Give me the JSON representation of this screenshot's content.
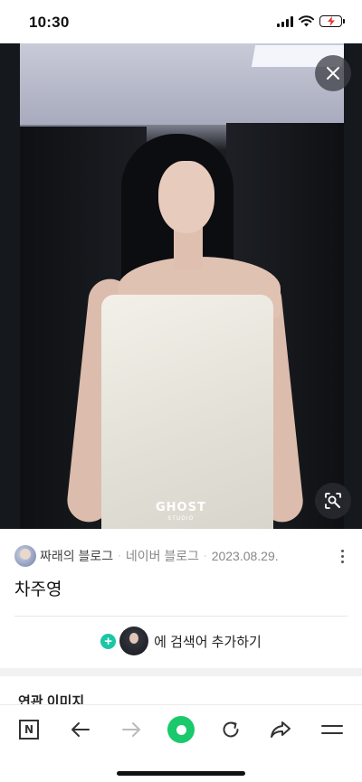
{
  "status_bar": {
    "time": "10:30",
    "icons": [
      "signal-icon",
      "wifi-icon",
      "battery-charging-icon"
    ]
  },
  "viewer": {
    "watermark": "GHOST",
    "watermark_sub": "STUDIO",
    "close_icon": "close-icon",
    "lens_icon": "image-search-icon"
  },
  "info": {
    "source_name": "짜래의 블로그",
    "source_site": "네이버 블로그",
    "date": "2023.08.29.",
    "title": "차주영",
    "add_search_label": "에 검색어 추가하기",
    "related_heading": "연관 이미지"
  },
  "toolbar": {
    "items": [
      "n-home-icon",
      "back-icon",
      "forward-icon",
      "green-dot-icon",
      "refresh-icon",
      "share-icon",
      "menu-icon"
    ],
    "n_label": "N"
  },
  "colors": {
    "accent_green": "#19c96b",
    "plus_teal": "#19c6a6"
  }
}
